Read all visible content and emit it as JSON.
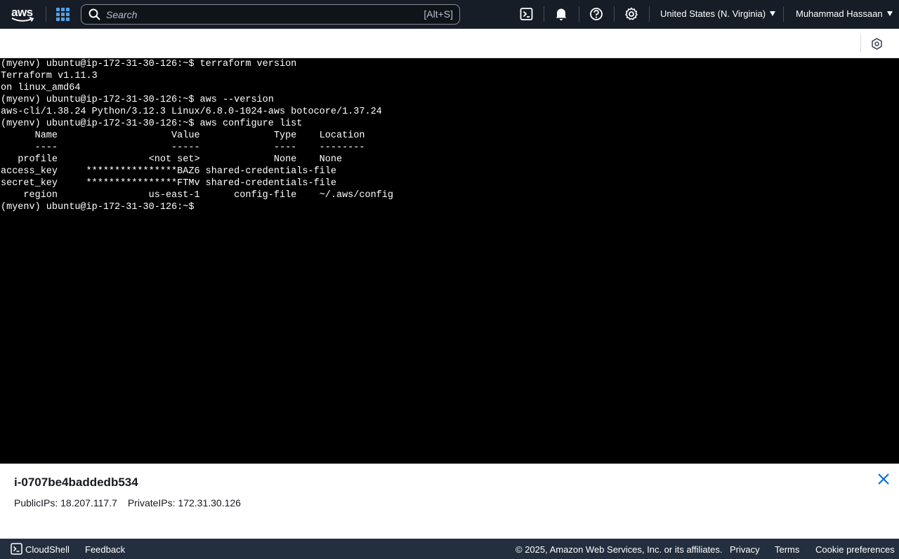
{
  "nav": {
    "logo_text": "aws",
    "search_placeholder": "Search",
    "search_shortcut": "[Alt+S]",
    "region": "United States (N. Virginia)",
    "user": "Muhammad Hassaan",
    "icons": [
      "cloudshell-icon",
      "bell-icon",
      "help-icon",
      "gear-icon"
    ]
  },
  "terminal": {
    "lines": [
      "(myenv) ubuntu@ip-172-31-30-126:~$ terraform version",
      "Terraform v1.11.3",
      "on linux_amd64",
      "(myenv) ubuntu@ip-172-31-30-126:~$ aws --version",
      "aws-cli/1.38.24 Python/3.12.3 Linux/6.8.0-1024-aws botocore/1.37.24",
      "(myenv) ubuntu@ip-172-31-30-126:~$ aws configure list",
      "      Name                    Value             Type    Location",
      "      ----                    -----             ----    --------",
      "   profile                <not set>             None    None",
      "access_key     ****************BAZ6 shared-credentials-file",
      "secret_key     ****************FTMv shared-credentials-file",
      "    region                us-east-1      config-file    ~/.aws/config",
      "(myenv) ubuntu@ip-172-31-30-126:~$"
    ]
  },
  "instance": {
    "id": "i-0707be4baddedb534",
    "public_ips_label": "PublicIPs: 18.207.117.7",
    "private_ips_label": "PrivateIPs: 172.31.30.126"
  },
  "footer": {
    "cloudshell": "CloudShell",
    "feedback": "Feedback",
    "copyright": "© 2025, Amazon Web Services, Inc. or its affiliates.",
    "privacy": "Privacy",
    "terms": "Terms",
    "cookie": "Cookie preferences"
  },
  "colors": {
    "nav_bg": "#161d26",
    "footer_bg": "#232f3e",
    "accent_blue": "#539fe5",
    "link_blue": "#0972d3",
    "terminal_bg": "#000000"
  }
}
